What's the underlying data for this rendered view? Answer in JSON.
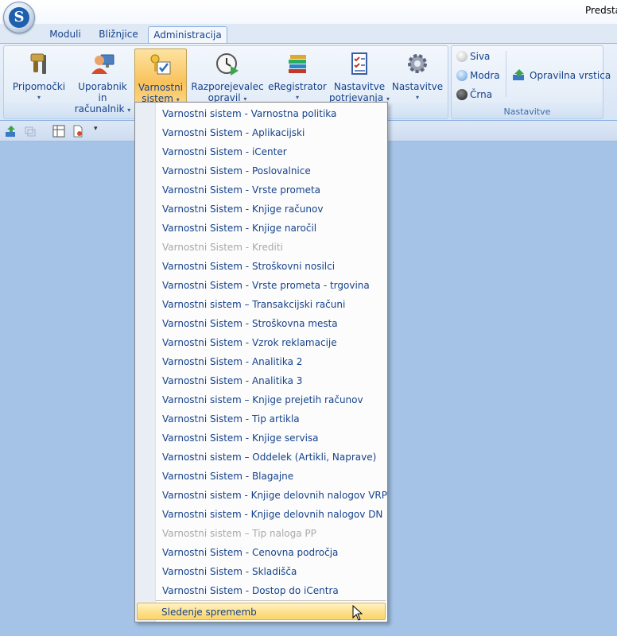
{
  "window": {
    "title": "Predstav"
  },
  "tabs": [
    {
      "label": "Moduli"
    },
    {
      "label": "Bližnjice"
    },
    {
      "label": "Administracija",
      "active": true
    }
  ],
  "ribbon": {
    "buttons": {
      "pripomocki": {
        "line1": "Pripomočki",
        "icon": "tools-icon"
      },
      "uporabnik": {
        "line1": "Uporabnik in",
        "line2": "računalnik",
        "icon": "user-computer-icon"
      },
      "varnostni": {
        "line1": "Varnostni",
        "line2": "sistem",
        "icon": "security-keys-icon"
      },
      "razporejevalec": {
        "line1": "Razporejevalec",
        "line2": "opravil",
        "icon": "clock-play-icon"
      },
      "eregistrator": {
        "line1": "eRegistrator",
        "icon": "books-icon"
      },
      "nastavitve_potr": {
        "line1": "Nastavitve",
        "line2": "potrjevanja",
        "icon": "checklist-icon"
      },
      "nastavitve": {
        "line1": "Nastavitve",
        "icon": "gear-icon"
      }
    },
    "nastavitve_group": {
      "label": "Nastavitve",
      "themes": [
        {
          "label": "Siva",
          "color": "#b4b4b4"
        },
        {
          "label": "Modra",
          "color": "#5b9ae0"
        },
        {
          "label": "Črna",
          "color": "#1f1f1f"
        }
      ],
      "opravilna": "Opravilna vrstica"
    }
  },
  "menu": {
    "items": [
      {
        "label": "Varnostni sistem - Varnostna politika",
        "disabled": false
      },
      {
        "label": "Varnostni Sistem - Aplikacijski",
        "disabled": false
      },
      {
        "label": "Varnostni Sistem - iCenter",
        "disabled": false
      },
      {
        "label": "Varnostni Sistem - Poslovalnice",
        "disabled": false
      },
      {
        "label": "Varnostni Sistem - Vrste prometa",
        "disabled": false
      },
      {
        "label": "Varnostni Sistem - Knjige računov",
        "disabled": false
      },
      {
        "label": "Varnostni Sistem - Knjige naročil",
        "disabled": false
      },
      {
        "label": "Varnostni Sistem - Krediti",
        "disabled": true
      },
      {
        "label": "Varnostni Sistem - Stroškovni nosilci",
        "disabled": false
      },
      {
        "label": "Varnostni Sistem - Vrste prometa - trgovina",
        "disabled": false
      },
      {
        "label": "Varnostni sistem – Transakcijski računi",
        "disabled": false
      },
      {
        "label": "Varnostni Sistem - Stroškovna mesta",
        "disabled": false
      },
      {
        "label": "Varnostni Sistem - Vzrok reklamacije",
        "disabled": false
      },
      {
        "label": "Varnostni Sistem - Analitika 2",
        "disabled": false
      },
      {
        "label": "Varnostni Sistem - Analitika 3",
        "disabled": false
      },
      {
        "label": "Varnostni sistem – Knjige prejetih računov",
        "disabled": false
      },
      {
        "label": "Varnostni Sistem - Tip artikla",
        "disabled": false
      },
      {
        "label": "Varnostni Sistem - Knjige servisa",
        "disabled": false
      },
      {
        "label": "Varnostni sistem – Oddelek (Artikli, Naprave)",
        "disabled": false
      },
      {
        "label": "Varnostni Sistem - Blagajne",
        "disabled": false
      },
      {
        "label": "Varnostni sistem - Knjige delovnih nalogov VRP",
        "disabled": false
      },
      {
        "label": "Varnostni sistem - Knjige delovnih nalogov DN",
        "disabled": false
      },
      {
        "label": "Varnostni sistem – Tip naloga PP",
        "disabled": true
      },
      {
        "label": "Varnostni Sistem - Cenovna področja",
        "disabled": false
      },
      {
        "label": "Varnostni Sistem - Skladišča",
        "disabled": false
      },
      {
        "label": "Varnostni Sistem - Dostop do iCentra",
        "disabled": false
      }
    ],
    "footer": "Sledenje sprememb"
  }
}
